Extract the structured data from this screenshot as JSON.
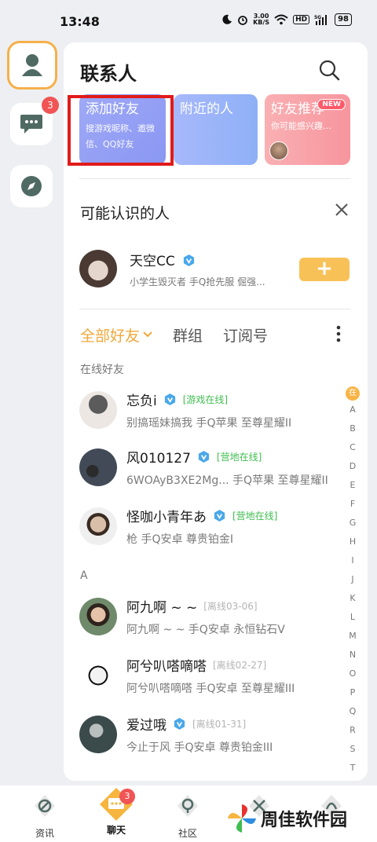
{
  "status_bar": {
    "time": "13:48",
    "speed_value": "3.00",
    "speed_unit": "KB/S",
    "hd": "HD",
    "network": "5G",
    "battery": "98"
  },
  "rail": {
    "chat_badge": "3"
  },
  "header": {
    "title": "联系人"
  },
  "tiles": {
    "add_title": "添加好友",
    "add_sub": "搜游戏昵称、邀微信、QQ好友",
    "near_title": "附近的人",
    "rec_title": "好友推荐",
    "rec_sub": "你可能感兴趣...",
    "rec_badge": "NEW"
  },
  "suggest": {
    "section_title": "可能认识的人",
    "name": "天空CC",
    "desc": "小学生毁灭者 手Q抢先服 倔强...",
    "add_label": "+"
  },
  "tabs": {
    "all_friends": "全部好友",
    "groups": "群组",
    "subscriptions": "订阅号"
  },
  "groups": {
    "online_label": "在线好友",
    "a_label": "A"
  },
  "friends": [
    {
      "name": "忘负i",
      "tag": "[游戏在线]",
      "detail": "别搞瑶妹搞我   手Q苹果   至尊星耀II"
    },
    {
      "name": "风010127",
      "tag": "[营地在线]",
      "detail": "6WOAyB3XE2Mg...   手Q苹果   至尊星耀II"
    },
    {
      "name": "怪咖小青年あ",
      "tag": "[营地在线]",
      "detail": "枪   手Q安卓   尊贵铂金I"
    },
    {
      "name": "阿九啊 ~ ~",
      "tag": "[离线03-06]",
      "detail": "阿九啊 ~ ~   手Q安卓   永恒钻石V"
    },
    {
      "name": "阿兮叭嗒嘀嗒",
      "tag": "[离线02-27]",
      "detail": "阿兮叭嗒嘀嗒   手Q安卓   至尊星耀III"
    },
    {
      "name": "爱过哦",
      "tag": "[离线01-31]",
      "detail": "今止于风   手Q安卓   尊贵铂金III"
    }
  ],
  "alpha_index": {
    "active": "在",
    "letters": [
      "A",
      "B",
      "C",
      "D",
      "E",
      "F",
      "G",
      "H",
      "I",
      "J",
      "K",
      "L",
      "M",
      "N",
      "O",
      "P",
      "Q",
      "R",
      "S",
      "T"
    ]
  },
  "bottom_nav": {
    "news": "资讯",
    "chat": "聊天",
    "community": "社区",
    "chat_badge": "3"
  },
  "watermark": {
    "text": "周佳软件园"
  },
  "colors": {
    "accent": "#f0a83a",
    "online": "#3fbd4f",
    "offline": "#b4b4b4",
    "badge": "#f05454",
    "highlight": "#e11b1b"
  }
}
